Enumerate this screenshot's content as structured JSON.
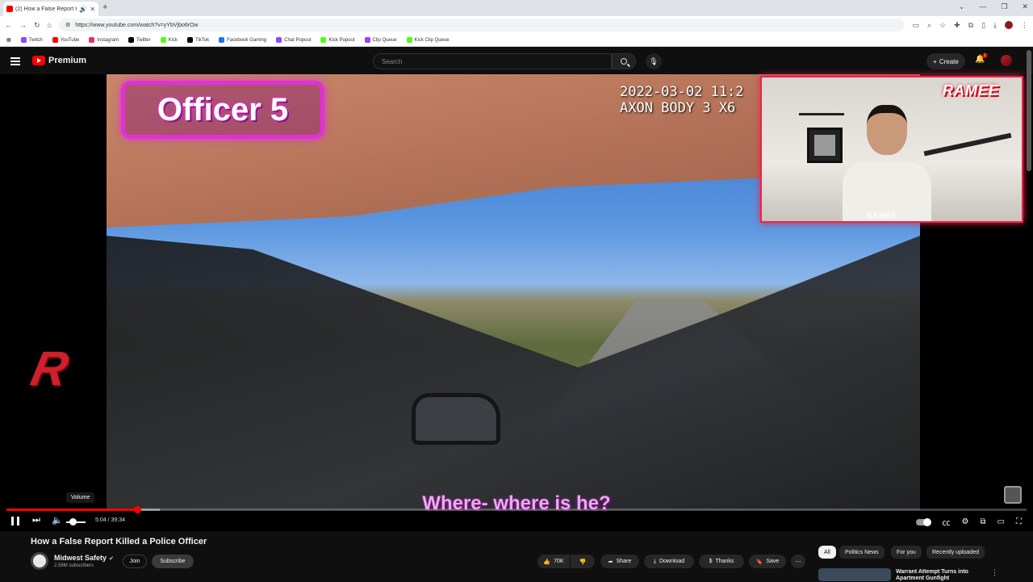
{
  "browser": {
    "tab_title": "(2) How a False Report Killed a Police Officer",
    "url": "https://www.youtube.com/watch?v=yYbVjbo6rOw",
    "bookmarks": [
      {
        "label": "Twitch",
        "color": "#9146ff"
      },
      {
        "label": "YouTube",
        "color": "#ff0000"
      },
      {
        "label": "Instagram",
        "color": "#e1306c"
      },
      {
        "label": "Twitter",
        "color": "#000000"
      },
      {
        "label": "Kick",
        "color": "#53fc18"
      },
      {
        "label": "TikTok",
        "color": "#000000"
      },
      {
        "label": "Facebook Gaming",
        "color": "#1877f2"
      },
      {
        "label": "Chat Popout",
        "color": "#9146ff"
      },
      {
        "label": "Kick Popout",
        "color": "#53fc18"
      },
      {
        "label": "Clip Queue",
        "color": "#9146ff"
      },
      {
        "label": "Kick Clip Queue",
        "color": "#53fc18"
      }
    ]
  },
  "header": {
    "logo_text": "Premium",
    "search_placeholder": "Search",
    "create_label": "Create",
    "notification_count": "2"
  },
  "player": {
    "timestamp": "2022-03-02 11:2\nAXON BODY 3 X6",
    "officer_label": "Officer 5",
    "webcam_brand": "RAMEE",
    "caption": "Where- where is he?",
    "volume_tooltip": "Volume",
    "time_current": "5:04",
    "time_total": "39:34",
    "progress_fraction": 0.128,
    "buffer_fraction": 0.15
  },
  "video": {
    "title": "How a False Report Killed a Police Officer",
    "channel_name": "Midwest Safety",
    "subscribers": "2.56M subscribers",
    "join_label": "Join",
    "subscribe_label": "Subscribe",
    "likes": "70K",
    "share_label": "Share",
    "download_label": "Download",
    "thanks_label": "Thanks",
    "save_label": "Save"
  },
  "sidebar": {
    "chips": [
      "All",
      "Politics News",
      "For you",
      "Recently uploaded"
    ],
    "recommendation_title": "Warrant Attempt Turns into Apartment Gunfight"
  }
}
